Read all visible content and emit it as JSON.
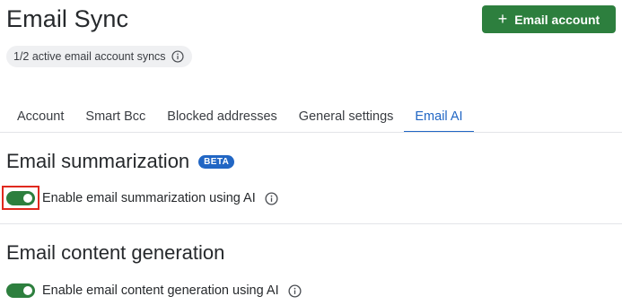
{
  "page": {
    "title": "Email Sync"
  },
  "status_badge": {
    "text": "1/2 active email account syncs",
    "icon": "info-icon"
  },
  "add_button": {
    "label": "Email account",
    "icon": "plus-icon",
    "color": "#2d7f3e"
  },
  "tabs": [
    {
      "label": "Account",
      "active": false
    },
    {
      "label": "Smart Bcc",
      "active": false
    },
    {
      "label": "Blocked addresses",
      "active": false
    },
    {
      "label": "General settings",
      "active": false
    },
    {
      "label": "Email AI",
      "active": true
    }
  ],
  "accent_color": "#2166c4",
  "highlight_color": "#e0291e",
  "sections": {
    "summarization": {
      "title": "Email summarization",
      "badge": "BETA",
      "toggle_label": "Enable email summarization using AI",
      "toggle_on": true
    },
    "generation": {
      "title": "Email content generation",
      "toggle_label": "Enable email content generation using AI",
      "toggle_on": true
    }
  }
}
